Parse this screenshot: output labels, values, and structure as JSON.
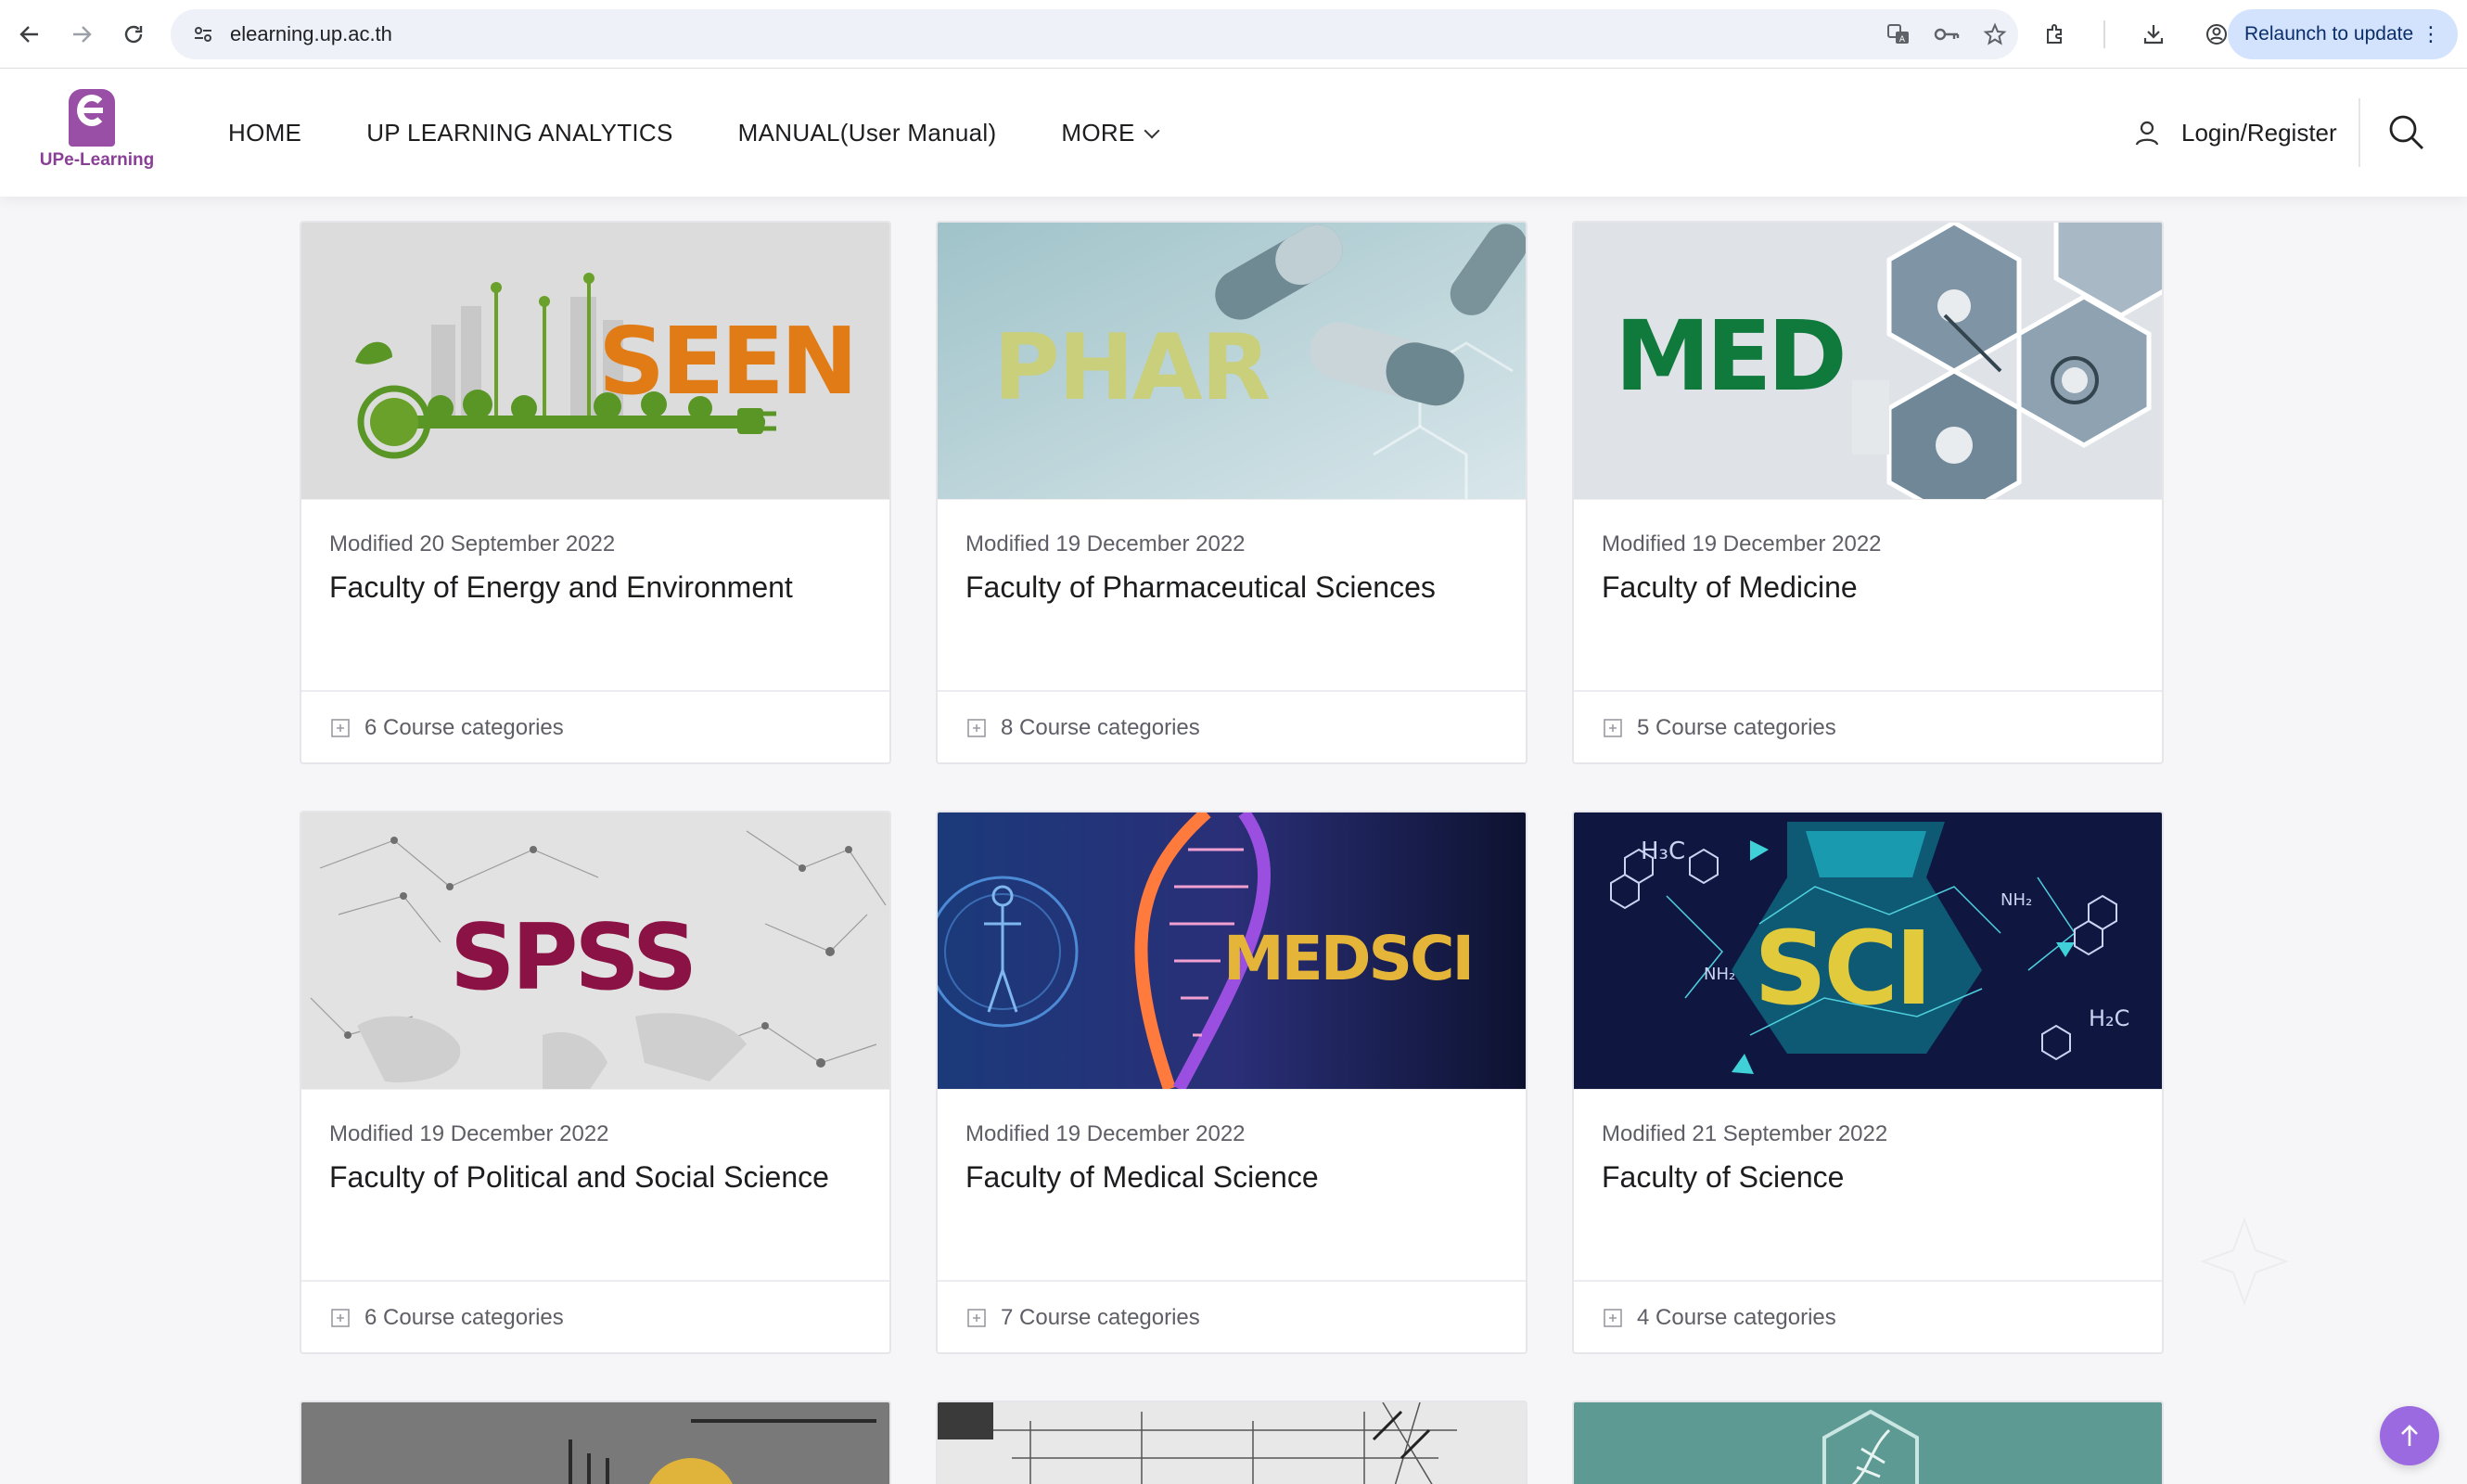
{
  "browser": {
    "url": "elearning.up.ac.th",
    "relaunch_label": "Relaunch to update"
  },
  "site": {
    "logo_text": "UPe-Learning",
    "nav": [
      {
        "label": "HOME"
      },
      {
        "label": "UP LEARNING ANALYTICS"
      },
      {
        "label": "MANUAL(User Manual)"
      },
      {
        "label": "MORE"
      }
    ],
    "login_label": "Login/Register"
  },
  "cards": [
    {
      "abbr": "SEEN",
      "modified": "Modified 20 September 2022",
      "title": "Faculty of Energy and Environment",
      "count": "6 Course categories"
    },
    {
      "abbr": "PHAR",
      "modified": "Modified 19 December 2022",
      "title": "Faculty of Pharmaceutical Sciences",
      "count": "8 Course categories"
    },
    {
      "abbr": "MED",
      "modified": "Modified 19 December 2022",
      "title": "Faculty of Medicine",
      "count": "5 Course categories"
    },
    {
      "abbr": "SPSS",
      "modified": "Modified 19 December 2022",
      "title": "Faculty of Political and Social Science",
      "count": "6 Course categories"
    },
    {
      "abbr": "MEDSCI",
      "modified": "Modified 19 December 2022",
      "title": "Faculty of Medical Science",
      "count": "7 Course categories"
    },
    {
      "abbr": "SCI",
      "modified": "Modified 21 September 2022",
      "title": "Faculty of Science",
      "count": "4 Course categories"
    }
  ],
  "colors": {
    "brand": "#9a4fa6",
    "accent_button": "#9b6ae0",
    "seen": "#e07b16",
    "med": "#0f7a3c",
    "spss": "#8b1245",
    "medsci": "#e5b53a",
    "sci": "#e1cb3c"
  }
}
